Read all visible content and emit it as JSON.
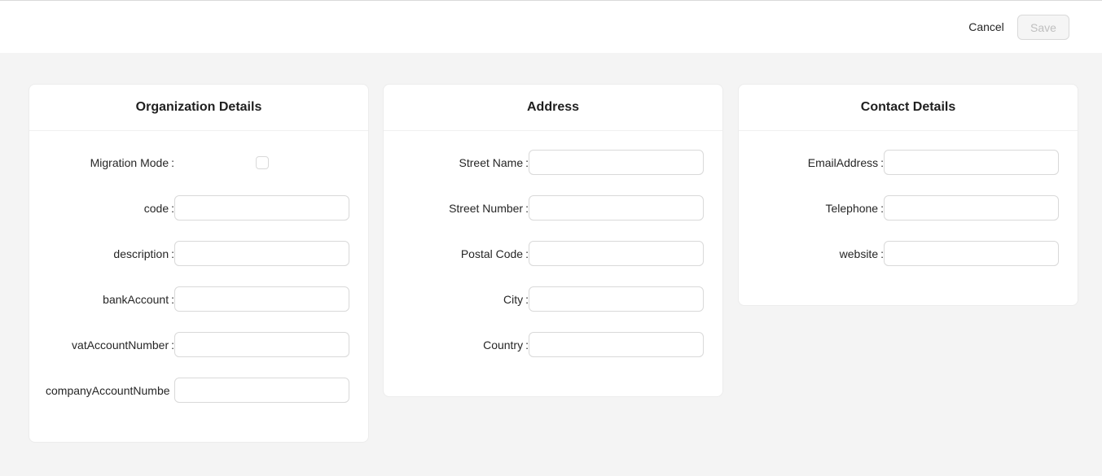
{
  "toolbar": {
    "cancel_label": "Cancel",
    "save_label": "Save"
  },
  "organization": {
    "title": "Organization Details",
    "migration_mode_label": "Migration Mode",
    "migration_mode_checked": false,
    "fields": [
      {
        "label": "code",
        "value": ""
      },
      {
        "label": "description",
        "value": ""
      },
      {
        "label": "bankAccount",
        "value": ""
      },
      {
        "label": "vatAccountNumber",
        "value": ""
      },
      {
        "label": "companyAccountNumbe",
        "value": ""
      }
    ]
  },
  "address": {
    "title": "Address",
    "fields": [
      {
        "label": "Street Name",
        "value": ""
      },
      {
        "label": "Street Number",
        "value": ""
      },
      {
        "label": "Postal Code",
        "value": ""
      },
      {
        "label": "City",
        "value": ""
      },
      {
        "label": "Country",
        "value": ""
      }
    ]
  },
  "contact": {
    "title": "Contact Details",
    "fields": [
      {
        "label": "EmailAddress",
        "value": ""
      },
      {
        "label": "Telephone",
        "value": ""
      },
      {
        "label": "website",
        "value": ""
      }
    ]
  },
  "colon": ":"
}
